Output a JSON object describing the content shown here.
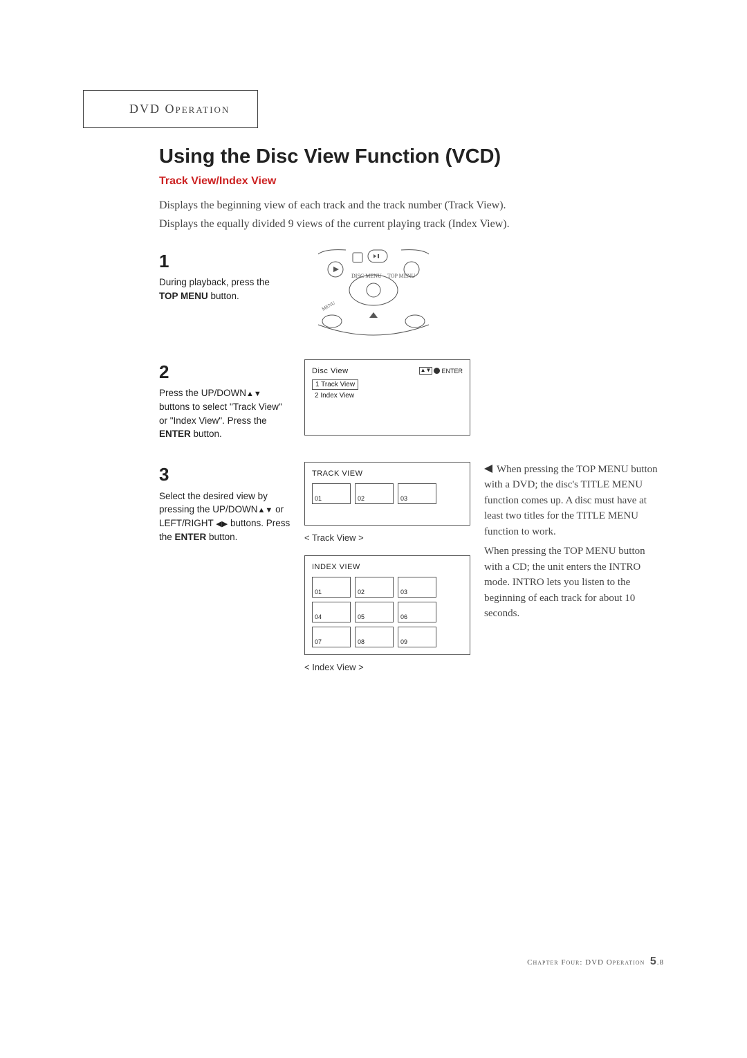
{
  "section_tag": "DVD Operation",
  "heading": "Using the Disc View Function (VCD)",
  "subheading": "Track View/Index View",
  "intro": {
    "line1": "Displays the beginning view of each track and the track number (Track View).",
    "line2": "Displays the equally divided 9 views of the current playing track (Index View)."
  },
  "steps": {
    "s1": {
      "num": "1",
      "text_a": "During playback, press the ",
      "bold": "TOP MENU",
      "text_b": " button.",
      "remote_labels": {
        "disc_menu": "DISC MENU",
        "top_menu": "TOP MENU",
        "menu": "MENU"
      }
    },
    "s2": {
      "num": "2",
      "text_a": "Press the UP/DOWN",
      "arrows": "▲▼",
      "text_b": " buttons to select \"Track View\" or \"Index View\". Press the ",
      "bold": "ENTER",
      "text_c": " button.",
      "osd": {
        "title": "Disc View",
        "indicator": {
          "arrows": "▲▼",
          "enter": "ENTER"
        },
        "item1": "1  Track View",
        "item2": "2  Index View"
      }
    },
    "s3": {
      "num": "3",
      "text_a": "Select the desired view by pressing the UP/DOWN",
      "arrows1": "▲▼",
      "text_b": " or LEFT/RIGHT ",
      "arrows2": "◀▶",
      "text_c": " buttons. Press the ",
      "bold": "ENTER",
      "text_d": " button.",
      "track_view": {
        "title": "TRACK  VIEW",
        "cells": [
          "01",
          "02",
          "03"
        ],
        "caption": "< Track View >"
      },
      "index_view": {
        "title": "INDEX  VIEW",
        "cells": [
          "01",
          "02",
          "03",
          "04",
          "05",
          "06",
          "07",
          "08",
          "09"
        ],
        "caption": "< Index View >"
      }
    }
  },
  "side_note": {
    "p1a": "When pressing the TOP MENU button with a DVD; the disc's TITLE MENU function comes up. A disc must have at least two titles for the TITLE MENU function to work.",
    "p2": "When pressing the TOP MENU button with a CD; the unit enters the INTRO mode. INTRO lets you listen to the beginning of each track for about 10 seconds."
  },
  "footer": {
    "chapter": "Chapter Four: DVD Operation",
    "page_major": "5",
    "page_minor": ".8"
  }
}
